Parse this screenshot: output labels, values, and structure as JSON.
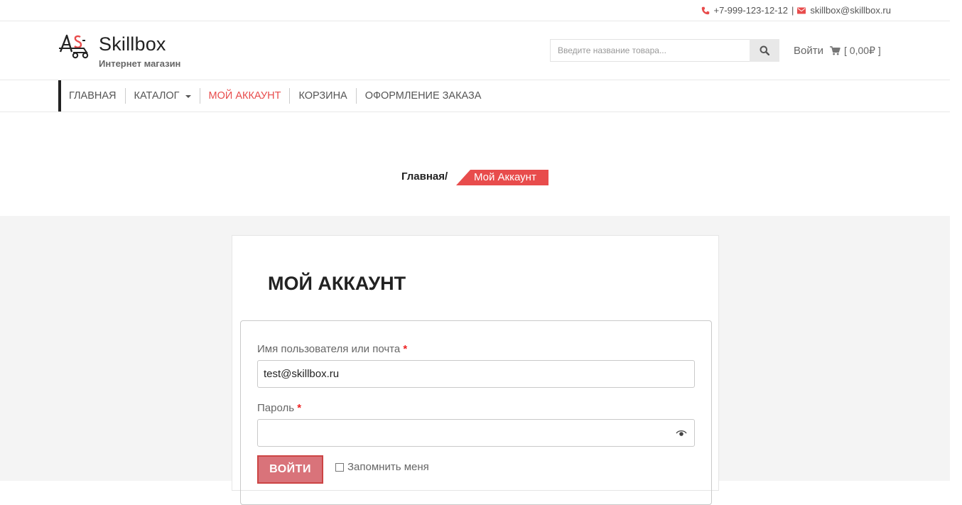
{
  "topbar": {
    "phone": "+7-999-123-12-12",
    "separator": "|",
    "email": "skillbox@skillbox.ru"
  },
  "brand": {
    "title": "Skillbox",
    "subtitle": "Интернет магазин"
  },
  "search": {
    "placeholder": "Введите название товара..."
  },
  "header": {
    "login_label": "Войти",
    "cart_label": "[ 0,00₽ ]"
  },
  "nav": {
    "items": [
      {
        "label": "ГЛАВНАЯ"
      },
      {
        "label": "КАТАЛОГ"
      },
      {
        "label": "МОЙ АККАУНТ"
      },
      {
        "label": "КОРЗИНА"
      },
      {
        "label": "ОФОРМЛЕНИЕ ЗАКАЗА"
      }
    ],
    "active_index": 2
  },
  "breadcrumb": {
    "home": "Главная",
    "divider": "/",
    "current": "Мой Аккаунт"
  },
  "account": {
    "title": "МОЙ АККАУНТ",
    "username_label": "Имя пользователя или почта",
    "required_mark": "*",
    "username_value": "test@skillbox.ru",
    "password_label": "Пароль",
    "password_value": "",
    "submit_label": "ВОЙТИ",
    "remember_label": "Запомнить меня"
  },
  "colors": {
    "accent": "#e84c4c",
    "button": "#d9737a",
    "content_bg": "#f4f4f4"
  }
}
